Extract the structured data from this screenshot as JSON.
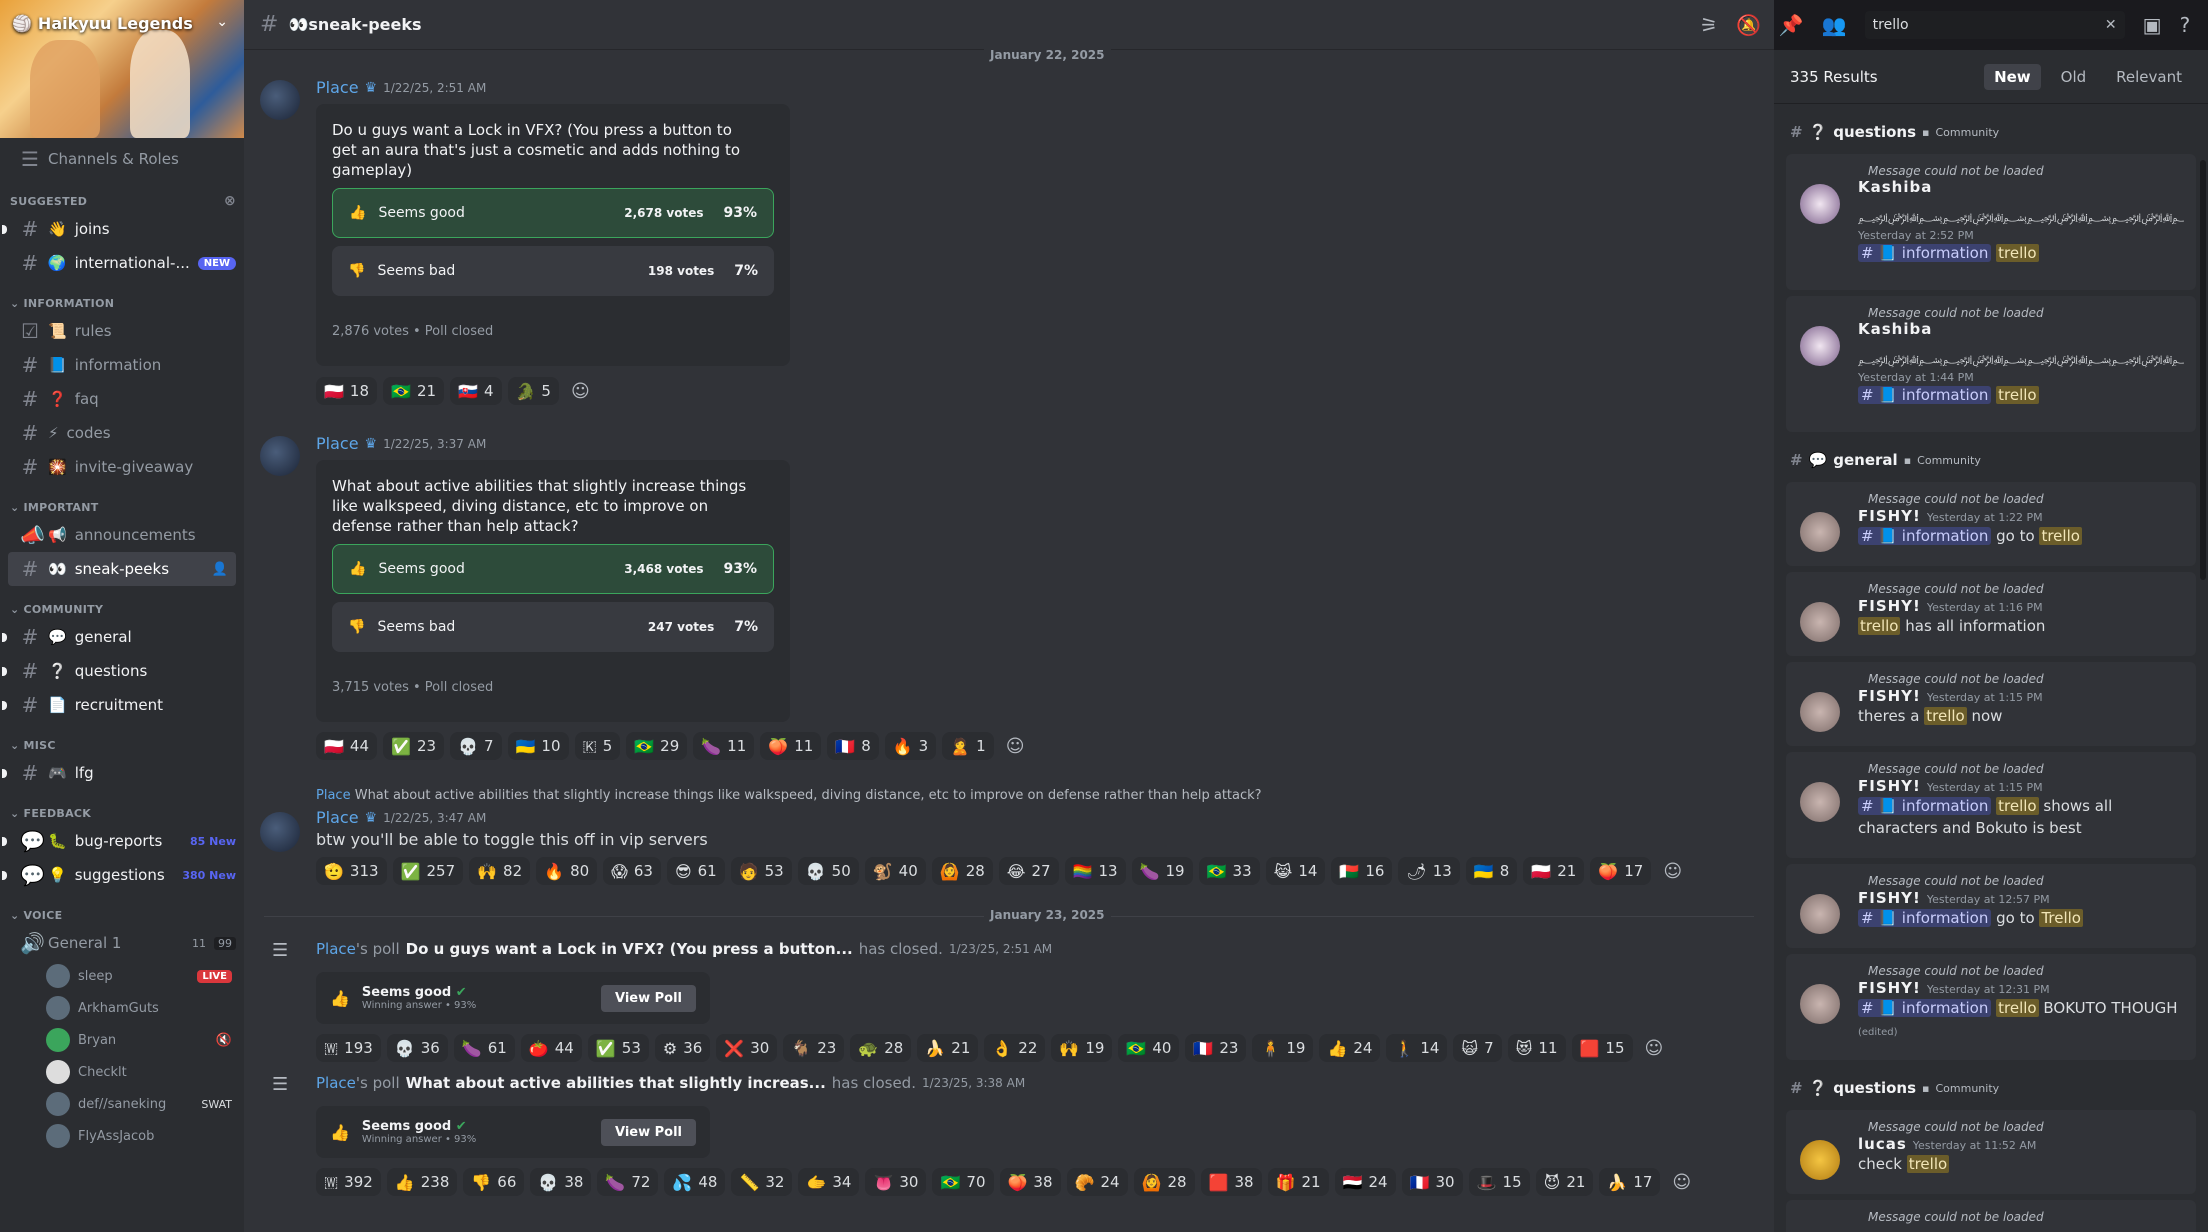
{
  "server": {
    "name": "Haikyuu Legends"
  },
  "sidebar": {
    "channels_roles": "Channels & Roles",
    "suggested_label": "SUGGESTED",
    "suggested": [
      {
        "emoji": "👋",
        "label": "joins"
      },
      {
        "emoji": "🌍",
        "label": "international-...",
        "badge": "NEW"
      }
    ],
    "information_label": "INFORMATION",
    "information": [
      {
        "emoji": "📜",
        "label": "rules"
      },
      {
        "emoji": "📘",
        "label": "information"
      },
      {
        "emoji": "❓",
        "label": "faq"
      },
      {
        "emoji": "⚡",
        "label": "codes"
      },
      {
        "emoji": "🎇",
        "label": "invite-giveaway"
      }
    ],
    "important_label": "IMPORTANT",
    "important": [
      {
        "emoji": "📢",
        "label": "announcements"
      },
      {
        "emoji": "👀",
        "label": "sneak-peeks"
      }
    ],
    "community_label": "COMMUNITY",
    "community": [
      {
        "emoji": "💬",
        "label": "general"
      },
      {
        "emoji": "❔",
        "label": "questions"
      },
      {
        "emoji": "📄",
        "label": "recruitment"
      }
    ],
    "misc_label": "MISC",
    "misc": [
      {
        "emoji": "🎮",
        "label": "lfg"
      }
    ],
    "feedback_label": "FEEDBACK",
    "feedback": [
      {
        "emoji": "🐛",
        "label": "bug-reports",
        "count": "85 New"
      },
      {
        "emoji": "💡",
        "label": "suggestions",
        "count": "380 New"
      }
    ],
    "voice_label": "VOICE",
    "voice_channel": {
      "label": "General 1",
      "count": "11",
      "limit": "99"
    },
    "voice_users": [
      {
        "name": "sleep",
        "live": "LIVE"
      },
      {
        "name": "ArkhamGuts"
      },
      {
        "name": "Bryan"
      },
      {
        "name": "Checklt"
      },
      {
        "name": "def//saneking",
        "tag": "SWAT"
      },
      {
        "name": "FlyAssJacob"
      }
    ]
  },
  "topbar": {
    "channel": "👀sneak-peeks",
    "search_value": "trello"
  },
  "messages": {
    "date1": "January 22, 2025",
    "date2": "January 23, 2025",
    "m1": {
      "user": "Place",
      "time": "1/22/25, 2:51 AM",
      "question": "Do u guys want a Lock in VFX? (You press a button to get an aura that's just a cosmetic and adds nothing to gameplay)",
      "opt1": "Seems good",
      "opt1_votes": "2,678 votes",
      "opt1_pct": "93%",
      "opt2": "Seems bad",
      "opt2_votes": "198 votes",
      "opt2_pct": "7%",
      "footer": "2,876 votes  •  Poll closed",
      "reactions": [
        {
          "e": "🇵🇱",
          "n": "18"
        },
        {
          "e": "🇧🇷",
          "n": "21"
        },
        {
          "e": "🇸🇰",
          "n": "4"
        },
        {
          "e": "🐊",
          "n": "5"
        }
      ]
    },
    "m2": {
      "user": "Place",
      "time": "1/22/25, 3:37 AM",
      "question": "What about active abilities that slightly increase things like walkspeed, diving distance, etc to improve on defense rather than help attack?",
      "opt1": "Seems good",
      "opt1_votes": "3,468 votes",
      "opt1_pct": "93%",
      "opt2": "Seems bad",
      "opt2_votes": "247 votes",
      "opt2_pct": "7%",
      "footer": "3,715 votes  •  Poll closed",
      "reactions": [
        {
          "e": "🇵🇱",
          "n": "44"
        },
        {
          "e": "✅",
          "n": "23"
        },
        {
          "e": "💀",
          "n": "7"
        },
        {
          "e": "🇺🇦",
          "n": "10"
        },
        {
          "e": "🇰",
          "n": "5"
        },
        {
          "e": "🇧🇷",
          "n": "29"
        },
        {
          "e": "🍆",
          "n": "11"
        },
        {
          "e": "🍑",
          "n": "11"
        },
        {
          "e": "🇫🇷",
          "n": "8"
        },
        {
          "e": "🔥",
          "n": "3"
        },
        {
          "e": "🙎",
          "n": "1"
        }
      ]
    },
    "m3": {
      "reply_user": "Place",
      "reply_text": "What about active abilities that slightly increase things like walkspeed, diving distance, etc to improve on defense rather than help attack?",
      "user": "Place",
      "time": "1/22/25, 3:47 AM",
      "text": "btw you'll be able to toggle this off in vip servers",
      "reactions": [
        {
          "e": "🫡",
          "n": "313"
        },
        {
          "e": "✅",
          "n": "257"
        },
        {
          "e": "🙌",
          "n": "82"
        },
        {
          "e": "🔥",
          "n": "80"
        },
        {
          "e": "😱",
          "n": "63"
        },
        {
          "e": "😎",
          "n": "61"
        },
        {
          "e": "🧑",
          "n": "53"
        },
        {
          "e": "💀",
          "n": "50"
        },
        {
          "e": "🐒",
          "n": "40"
        },
        {
          "e": "🙆",
          "n": "28"
        },
        {
          "e": "😂",
          "n": "27"
        },
        {
          "e": "🏳️‍🌈",
          "n": "13"
        },
        {
          "e": "🍆",
          "n": "19"
        },
        {
          "e": "🇧🇷",
          "n": "33"
        },
        {
          "e": "😹",
          "n": "14"
        },
        {
          "e": "🇲🇬",
          "n": "16"
        },
        {
          "e": "🌶",
          "n": "13"
        },
        {
          "e": "🇺🇦",
          "n": "8"
        },
        {
          "e": "🇵🇱",
          "n": "21"
        },
        {
          "e": "🍑",
          "n": "17"
        }
      ]
    },
    "s1": {
      "user": "Place",
      "mid": "'s poll",
      "bold": "Do u guys want a Lock in VFX? (You press a button...",
      "end": "has closed.",
      "time": "1/23/25, 2:51 AM",
      "win": "Seems good",
      "sub": "Winning answer • 93%",
      "btn": "View Poll",
      "reactions": [
        {
          "e": "🇼",
          "n": "193"
        },
        {
          "e": "💀",
          "n": "36"
        },
        {
          "e": "🍆",
          "n": "61"
        },
        {
          "e": "🍅",
          "n": "44"
        },
        {
          "e": "✅",
          "n": "53"
        },
        {
          "e": "⚙",
          "n": "36"
        },
        {
          "e": "❌",
          "n": "30"
        },
        {
          "e": "🐐",
          "n": "23"
        },
        {
          "e": "🐢",
          "n": "28"
        },
        {
          "e": "🍌",
          "n": "21"
        },
        {
          "e": "👌",
          "n": "22"
        },
        {
          "e": "🙌",
          "n": "19"
        },
        {
          "e": "🇧🇷",
          "n": "40"
        },
        {
          "e": "🇫🇷",
          "n": "23"
        },
        {
          "e": "🧍",
          "n": "19"
        },
        {
          "e": "👍",
          "n": "24"
        },
        {
          "e": "🚶",
          "n": "14"
        },
        {
          "e": "🙀",
          "n": "7"
        },
        {
          "e": "😻",
          "n": "11"
        },
        {
          "e": "🟥",
          "n": "15"
        }
      ]
    },
    "s2": {
      "user": "Place",
      "mid": "'s poll",
      "bold": "What about active abilities that slightly increas...",
      "end": "has closed.",
      "time": "1/23/25, 3:38 AM",
      "win": "Seems good",
      "sub": "Winning answer • 93%",
      "btn": "View Poll",
      "reactions": [
        {
          "e": "🇼",
          "n": "392"
        },
        {
          "e": "👍",
          "n": "238"
        },
        {
          "e": "👎",
          "n": "66"
        },
        {
          "e": "💀",
          "n": "38"
        },
        {
          "e": "🍆",
          "n": "72"
        },
        {
          "e": "💦",
          "n": "48"
        },
        {
          "e": "📏",
          "n": "32"
        },
        {
          "e": "🫱",
          "n": "34"
        },
        {
          "e": "👅",
          "n": "30"
        },
        {
          "e": "🇧🇷",
          "n": "70"
        },
        {
          "e": "🍑",
          "n": "38"
        },
        {
          "e": "🥐",
          "n": "24"
        },
        {
          "e": "🙆",
          "n": "28"
        },
        {
          "e": "🟥",
          "n": "38"
        },
        {
          "e": "🎁",
          "n": "21"
        },
        {
          "e": "🇾🇪",
          "n": "24"
        },
        {
          "e": "🇫🇷",
          "n": "30"
        },
        {
          "e": "🎩",
          "n": "15"
        },
        {
          "e": "😈",
          "n": "21"
        },
        {
          "e": "🍌",
          "n": "17"
        }
      ]
    }
  },
  "search": {
    "count": "335 Results",
    "tabs": [
      "New",
      "Old",
      "Relevant"
    ],
    "not_loaded": "Message could not be loaded",
    "community": "Community",
    "ch_questions": "questions",
    "ch_general": "general",
    "info_tag": "information",
    "r1": {
      "user": "Kashiba",
      "time": "Yesterday at 2:52 PM",
      "word": "trello"
    },
    "r2": {
      "user": "Kashiba",
      "time": "Yesterday at 1:44 PM",
      "word": "trello"
    },
    "r3": {
      "user": "FISHY!",
      "time": "Yesterday at 1:22 PM",
      "pre": "go to",
      "word": "trello"
    },
    "r4": {
      "user": "FISHY!",
      "time": "Yesterday at 1:16 PM",
      "word": "trello",
      "post": "has all information"
    },
    "r5": {
      "user": "FISHY!",
      "time": "Yesterday at 1:15 PM",
      "pre": "theres a",
      "word": "trello",
      "post": "now"
    },
    "r6": {
      "user": "FISHY!",
      "time": "Yesterday at 1:15 PM",
      "word": "trello",
      "post": "shows all characters and Bokuto is best"
    },
    "r7": {
      "user": "FISHY!",
      "time": "Yesterday at 12:57 PM",
      "pre": "go to",
      "word": "Trello"
    },
    "r8": {
      "user": "FISHY!",
      "time": "Yesterday at 12:31 PM",
      "word": "trello",
      "post": "BOKUTO THOUGH",
      "edited": "(edited)"
    },
    "r9": {
      "user": "lucas",
      "time": "Yesterday at 11:52 AM",
      "pre": "check",
      "word": "trello"
    }
  }
}
